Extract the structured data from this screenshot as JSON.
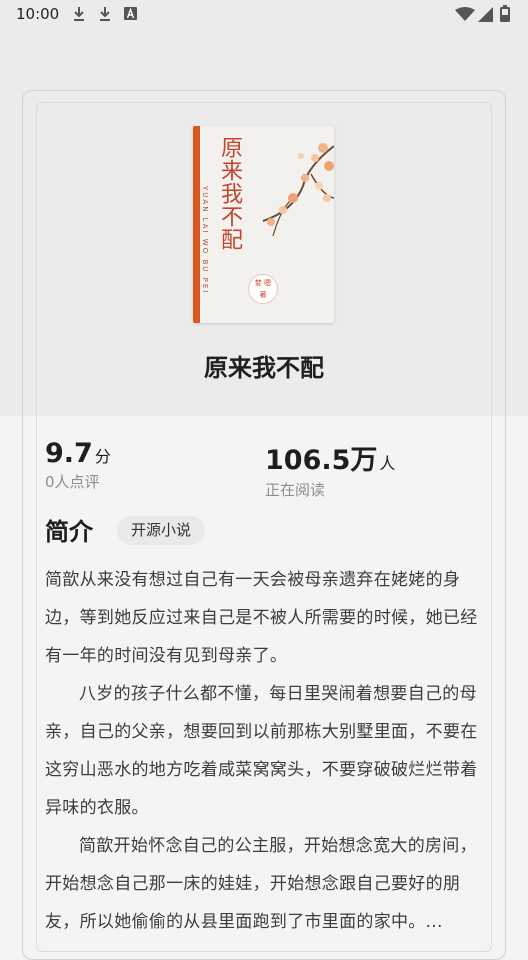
{
  "status_bar": {
    "time": "10:00",
    "icons": [
      "download-icon",
      "download-icon",
      "font-icon",
      "wifi-icon",
      "signal-icon",
      "battery-icon"
    ]
  },
  "book": {
    "title": "原来我不配",
    "cover": {
      "title": "原来我不配",
      "pinyin": "YUAN LAI WO BU PEI",
      "author": "婪 嗯",
      "author_suffix": "著"
    }
  },
  "stats": {
    "rating": {
      "value": "9.7",
      "unit": "分",
      "label": "0人点评"
    },
    "readers": {
      "value": "106.5万",
      "unit": "人",
      "label": "正在阅读"
    }
  },
  "intro": {
    "heading": "简介",
    "tag": "开源小说",
    "paragraphs": [
      "简歆从来没有想过自己有一天会被母亲遗弃在姥姥的身边，等到她反应过来自己是不被人所需要的时候，她已经有一年的时间没有见到母亲了。",
      "八岁的孩子什么都不懂，每日里哭闹着想要自己的母亲，自己的父亲，想要回到以前那栋大别墅里面，不要在这穷山恶水的地方吃着咸菜窝窝头，不要穿破破烂烂带着异味的衣服。",
      "简歆开始怀念自己的公主服，开始想念宽大的房间，开始想念自己那一床的娃娃，开始想念跟自己要好的朋友，所以她偷偷的从县里面跑到了市里面的家中。..."
    ]
  }
}
